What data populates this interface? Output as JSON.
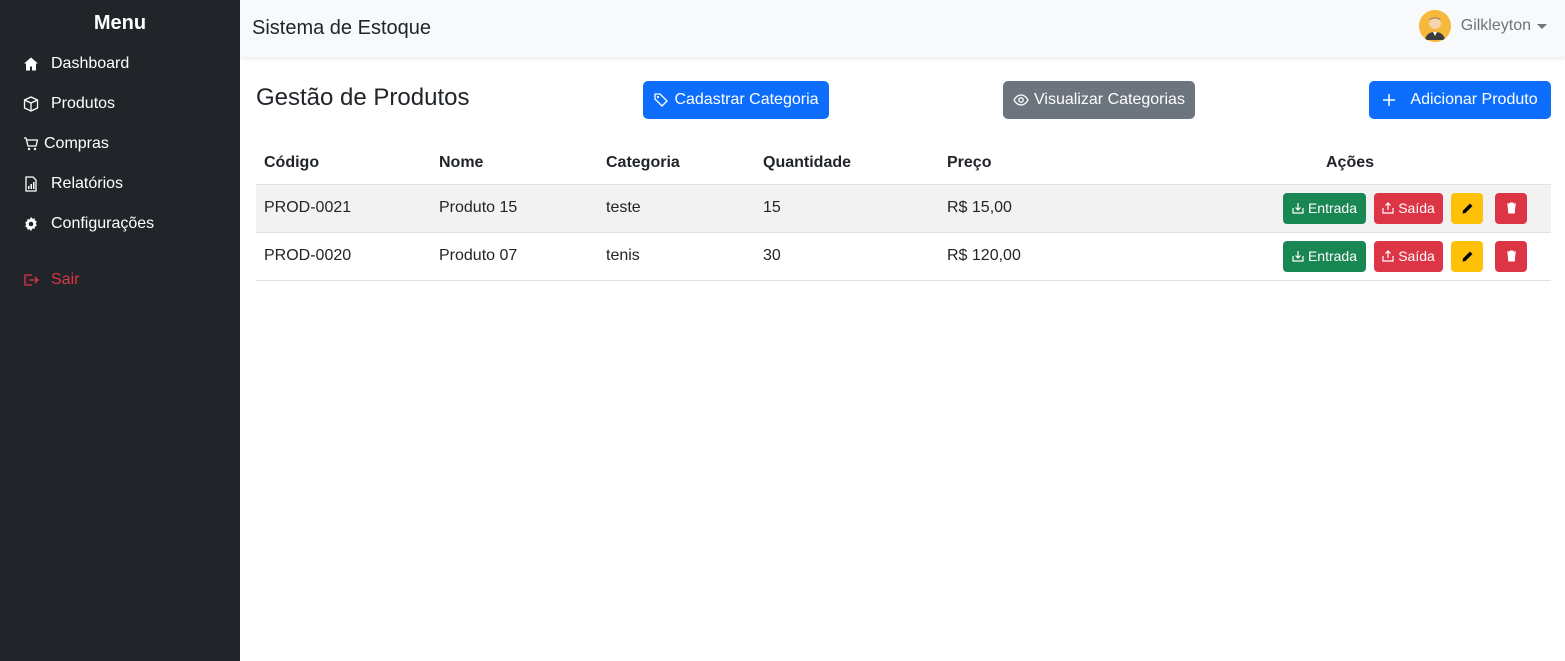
{
  "sidebar": {
    "title": "Menu",
    "items": [
      {
        "label": "Dashboard",
        "icon": "home-icon"
      },
      {
        "label": "Produtos",
        "icon": "box-icon"
      },
      {
        "label": "Compras",
        "icon": "cart-icon"
      },
      {
        "label": "Relatórios",
        "icon": "report-icon"
      },
      {
        "label": "Configurações",
        "icon": "gear-icon"
      }
    ],
    "logout": {
      "label": "Sair",
      "icon": "logout-icon"
    }
  },
  "topbar": {
    "brand": "Sistema de Estoque",
    "user": {
      "name": "Gilkleyton",
      "avatar_icon": "user-avatar-icon"
    }
  },
  "main": {
    "title": "Gestão de Produtos",
    "buttons": {
      "add_category": "Cadastrar Categoria",
      "view_categories": "Visualizar Categorias",
      "add_product": "Adicionar Produto"
    },
    "table": {
      "headers": [
        "Código",
        "Nome",
        "Categoria",
        "Quantidade",
        "Preço",
        "Ações"
      ],
      "rows": [
        {
          "code": "PROD-0021",
          "name": "Produto 15",
          "category": "teste",
          "quantity": "15",
          "price": "R$ 15,00"
        },
        {
          "code": "PROD-0020",
          "name": "Produto 07",
          "category": "tenis",
          "quantity": "30",
          "price": "R$ 120,00"
        }
      ],
      "actions": {
        "entrada": "Entrada",
        "saida": "Saída"
      }
    }
  },
  "colors": {
    "sidebar_bg": "#212529",
    "primary": "#0d6efd",
    "secondary": "#6c757d",
    "success": "#198754",
    "danger": "#dc3545",
    "warning": "#ffc107"
  }
}
